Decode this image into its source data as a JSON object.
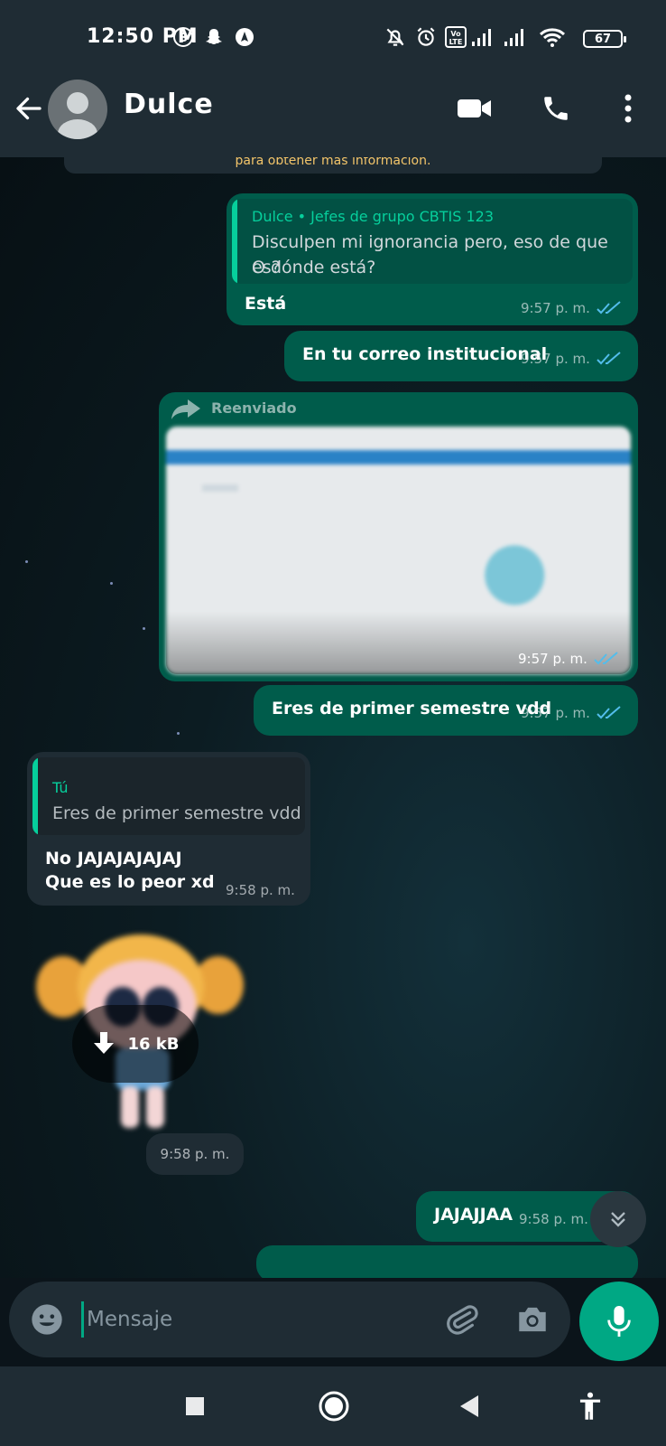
{
  "status_bar": {
    "time": "12:50 PM",
    "volte_label": "Vo\nLTE",
    "battery": "67",
    "icons": [
      "bereal-icon",
      "snapchat-icon",
      "navigation-icon",
      "mute-icon",
      "alarm-icon",
      "volte-icon",
      "signal-icon",
      "signal-icon",
      "wifi-icon",
      "battery-icon"
    ]
  },
  "header": {
    "contact_name": "Dulce",
    "icons": [
      "back-arrow-icon",
      "avatar-icon",
      "video-call-icon",
      "phone-icon",
      "more-vert-icon"
    ]
  },
  "chat": {
    "system_notice": "para obtener más información.",
    "messages": [
      {
        "direction": "out",
        "quote_author": "Dulce • Jefes de grupo CBTIS 123",
        "quote_line1": "Disculpen mi ignorancia pero, eso de que es?",
        "quote_line2": "O dónde está?",
        "text": "Está",
        "time": "9:57 p. m.",
        "status": "read"
      },
      {
        "direction": "out",
        "text": "En tu correo institucional",
        "time": "9:57 p. m.",
        "status": "read"
      },
      {
        "direction": "out",
        "forwarded_label": "Reenviado",
        "type": "image",
        "time": "9:57 p. m.",
        "status": "read"
      },
      {
        "direction": "out",
        "text": "Eres de primer semestre vdd",
        "time": "9:57 p. m.",
        "status": "read"
      },
      {
        "direction": "in",
        "quote_author": "Tú",
        "quote_text": "Eres de primer semestre vdd",
        "text_line1": "No JAJAJAJAJAJ",
        "text_line2": "Que es lo peor xd",
        "time": "9:58 p. m."
      },
      {
        "direction": "in",
        "type": "sticker",
        "download_size": "16 kB",
        "time": "9:58 p. m."
      },
      {
        "direction": "out",
        "text": "JAJAJJAA",
        "time": "9:58 p. m.",
        "status": "read"
      }
    ]
  },
  "input": {
    "placeholder": "Mensaje"
  },
  "colors": {
    "accent": "#00a884",
    "outgoing_bubble": "#005c4b",
    "incoming_bubble": "#1f2c34",
    "read_ticks": "#53bdeb",
    "notice_text": "#f3c56a"
  }
}
